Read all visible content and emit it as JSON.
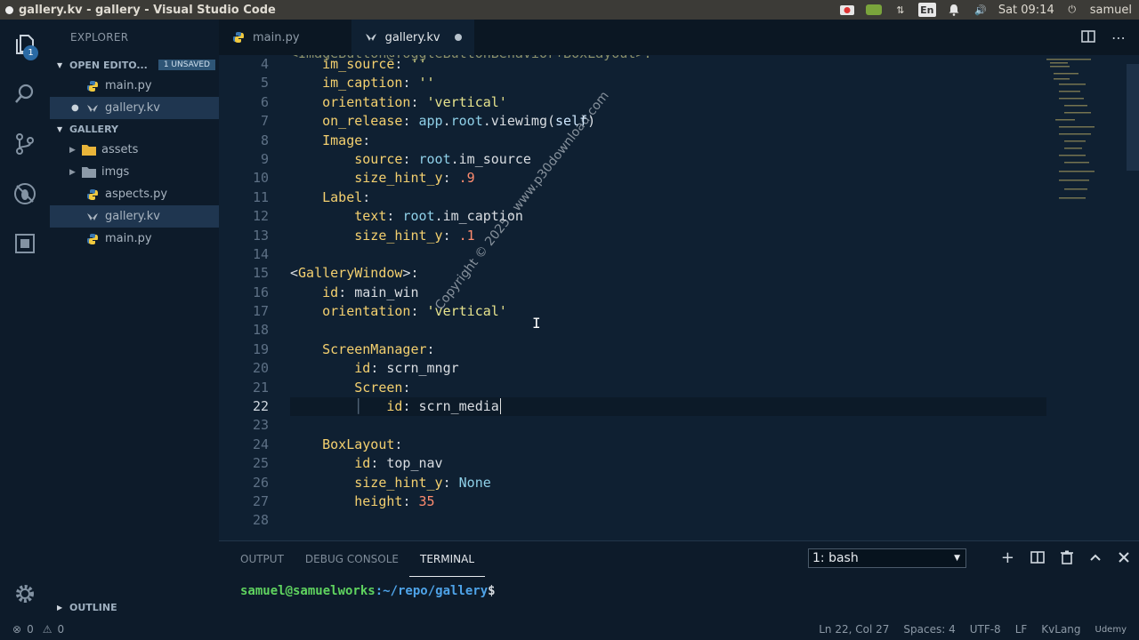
{
  "os": {
    "window_title": "gallery.kv - gallery - Visual Studio Code",
    "lang": "En",
    "clock": "Sat 09:14",
    "user": "samuel"
  },
  "activity": {
    "explorer_badge": "1"
  },
  "sidebar": {
    "title": "EXPLORER",
    "open_editors": {
      "label": "OPEN EDITO...",
      "unsaved": "1 UNSAVED",
      "items": [
        {
          "label": "main.py",
          "icon": "python-icon",
          "unsaved": false
        },
        {
          "label": "gallery.kv",
          "icon": "kivy-icon",
          "unsaved": true
        }
      ]
    },
    "gallery": {
      "label": "GALLERY",
      "items": [
        {
          "label": "assets",
          "icon": "folder-icon",
          "folder": true
        },
        {
          "label": "imgs",
          "icon": "folder-icon",
          "folder": true
        },
        {
          "label": "aspects.py",
          "icon": "python-icon",
          "folder": false
        },
        {
          "label": "gallery.kv",
          "icon": "kivy-icon",
          "folder": false
        },
        {
          "label": "main.py",
          "icon": "python-icon",
          "folder": false
        }
      ]
    },
    "outline": "OUTLINE"
  },
  "tabs": [
    {
      "label": "main.py",
      "active": false
    },
    {
      "label": "gallery.kv",
      "active": true,
      "modified": true
    }
  ],
  "editor": {
    "partial_top_line": "<ImageButton@ToggleButtonBehavior+BoxLayout>:",
    "current_line": 22,
    "line_numbers": [
      "4",
      "5",
      "6",
      "7",
      "8",
      "9",
      "10",
      "11",
      "12",
      "13",
      "14",
      "15",
      "16",
      "17",
      "18",
      "19",
      "20",
      "21",
      "22",
      "23",
      "24",
      "25",
      "26",
      "27",
      "28"
    ],
    "watermark": "Copyright © 2025 - www.p30download.com"
  },
  "panel": {
    "tabs": [
      "OUTPUT",
      "DEBUG CONSOLE",
      "TERMINAL"
    ],
    "active_tab": "TERMINAL",
    "terminal_select": "1: bash",
    "prompt_user": "samuel@samuelworks",
    "prompt_path": ":~/repo/gallery",
    "prompt_symbol": "$"
  },
  "status": {
    "errors": "0",
    "warnings": "0",
    "position": "Ln 22, Col 27",
    "spaces": "Spaces: 4",
    "encoding": "UTF-8",
    "eol": "LF",
    "language": "KvLang",
    "brand": "Udemy"
  },
  "colors": {
    "background": "#0f2032",
    "keyword": "#f4d06f",
    "string": "#e7e38d",
    "number": "#ff8c6f",
    "prompt_user": "#5fd35f",
    "prompt_path": "#4ea3e8"
  }
}
